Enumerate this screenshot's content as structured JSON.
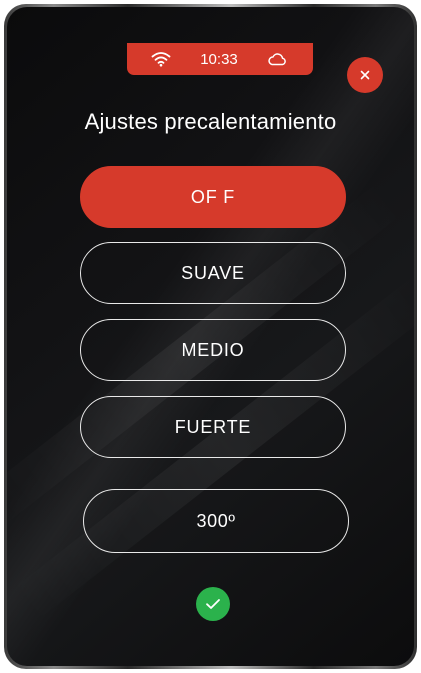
{
  "status_bar": {
    "time": "10:33",
    "wifi_icon": "wifi-icon",
    "cloud_icon": "cloud-icon",
    "color": "#d63a2b"
  },
  "header": {
    "title": "Ajustes precalentamiento",
    "close_icon": "close-icon"
  },
  "options": [
    {
      "label": "OF F",
      "selected": true
    },
    {
      "label": "SUAVE",
      "selected": false
    },
    {
      "label": "MEDIO",
      "selected": false
    },
    {
      "label": "FUERTE",
      "selected": false
    }
  ],
  "temperature": {
    "label": "300º"
  },
  "confirm": {
    "icon": "check-icon",
    "color": "#2bb24c"
  },
  "colors": {
    "accent": "#d63a2b",
    "confirm": "#2bb24c",
    "background": "#111113",
    "outline": "#e9e9e9"
  }
}
